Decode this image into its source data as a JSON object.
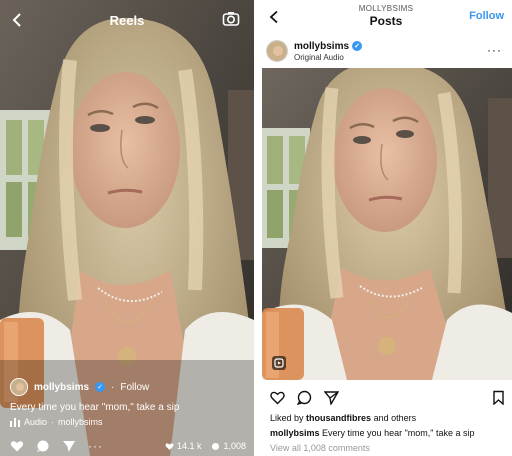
{
  "reels": {
    "title": "Reels",
    "username": "mollybsims",
    "follow_label": "Follow",
    "caption": "Every time you hear \"mom,\" take a sip",
    "audio_label": "Audio",
    "audio_user": "mollybsims",
    "likes": "14.1 k",
    "comments": "1,008"
  },
  "posts": {
    "super_title": "MOLLYBSIMS",
    "title": "Posts",
    "follow_label": "Follow",
    "username": "mollybsims",
    "subtitle": "Original Audio",
    "liked_by_prefix": "Liked by",
    "liked_by_user": "thousandfibres",
    "liked_by_suffix": "and others",
    "caption_user": "mollybsims",
    "caption_text": "Every time you hear \"mom,\" take a sip",
    "view_comments": "View all 1,008 comments"
  },
  "colors": {
    "accent": "#3897f0",
    "verified": "#3897f0"
  },
  "icons": {
    "back": "chevron-left-icon",
    "camera": "camera-icon",
    "heart": "heart-icon",
    "comment": "comment-icon",
    "share": "paper-plane-icon",
    "more": "more-dots-icon",
    "bookmark": "bookmark-icon"
  }
}
